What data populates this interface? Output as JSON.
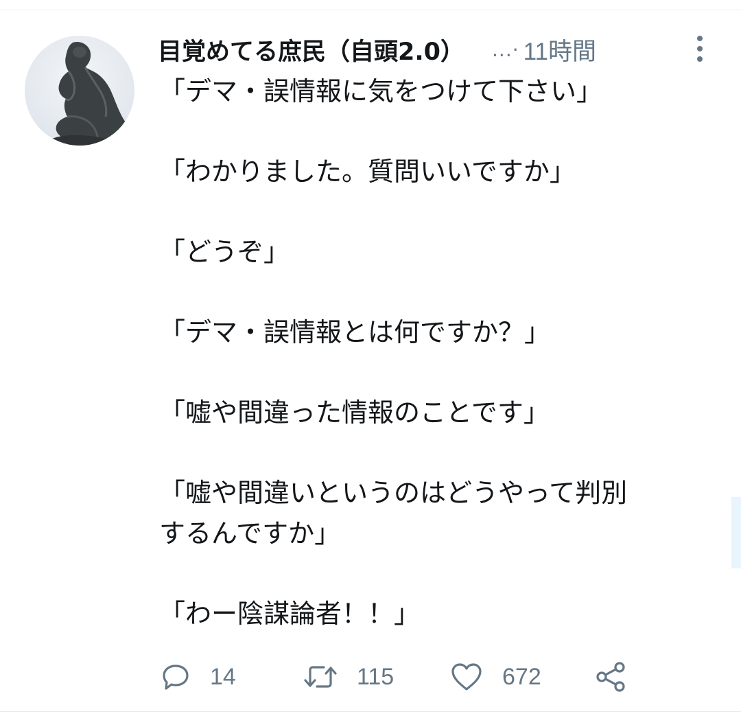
{
  "tweet": {
    "display_name": "目覚めてる庶民（自頭2.0）",
    "ellipsis": "...·",
    "time": "11時間",
    "text": "「デマ・誤情報に気をつけて下さい」\n\n「わかりました。質問いいですか」\n\n「どうぞ」\n\n「デマ・誤情報とは何ですか？」\n\n「嘘や間違った情報のことです」\n\n「嘘や間違いというのはどうやって判別\nするんですか」\n\n「わー陰謀論者！！」"
  },
  "actions": {
    "reply_count": "14",
    "retweet_count": "115",
    "like_count": "672"
  },
  "colors": {
    "text": "#14171a",
    "secondary": "#657786",
    "divider": "#e6ecf0"
  },
  "icons": {
    "avatar": "thinker-statue-avatar",
    "more": "more-vertical-icon",
    "reply": "reply-icon",
    "retweet": "retweet-icon",
    "like": "heart-icon",
    "share": "share-icon"
  }
}
